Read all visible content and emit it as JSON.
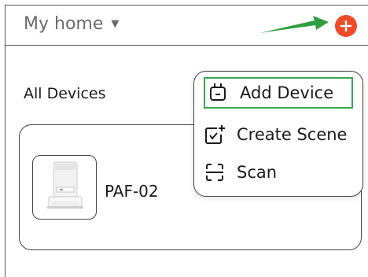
{
  "header": {
    "home_label": "My home",
    "caret_icon": "caret-down-icon",
    "add_icon": "plus-circle-icon",
    "add_color": "#ee4b2b"
  },
  "annotation": {
    "arrow_color": "#2e9e3e"
  },
  "devices_section": {
    "title": "All Devices",
    "devices": [
      {
        "name": "PAF-02",
        "image": "pet-feeder-device-image"
      }
    ]
  },
  "add_menu": {
    "highlight_color": "#3aa84a",
    "items": [
      {
        "label": "Add Device",
        "icon": "plug-icon"
      },
      {
        "label": "Create Scene",
        "icon": "scene-add-icon"
      },
      {
        "label": "Scan",
        "icon": "scan-icon"
      }
    ]
  }
}
